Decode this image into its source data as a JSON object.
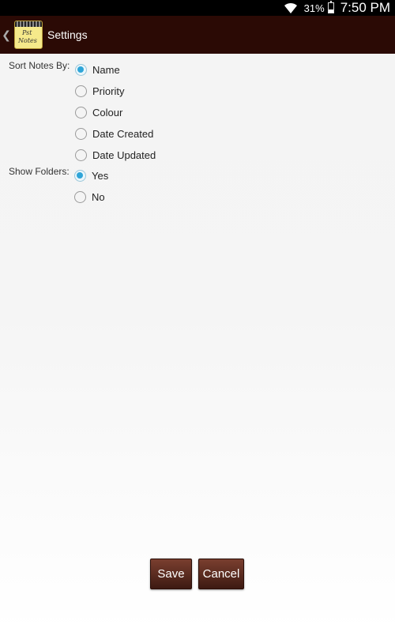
{
  "status_bar": {
    "battery": "31%",
    "time": "7:50 PM",
    "icons": [
      "wifi-icon",
      "battery-icon"
    ]
  },
  "action_bar": {
    "title": "Settings",
    "up_icon": "chevron-left-icon",
    "app_icon_text": [
      "Pst",
      "Notes"
    ]
  },
  "sort_group": {
    "label": "Sort Notes By:",
    "selected": "Name",
    "options": [
      "Name",
      "Priority",
      "Colour",
      "Date Created",
      "Date Updated"
    ]
  },
  "folders_group": {
    "label": "Show Folders:",
    "selected": "Yes",
    "options": [
      "Yes",
      "No"
    ]
  },
  "buttons": {
    "save": "Save",
    "cancel": "Cancel"
  },
  "colors": {
    "action_bar": "#2b0a05",
    "radio_checked": "#2fa5d8",
    "button": "#5a2a1e"
  }
}
